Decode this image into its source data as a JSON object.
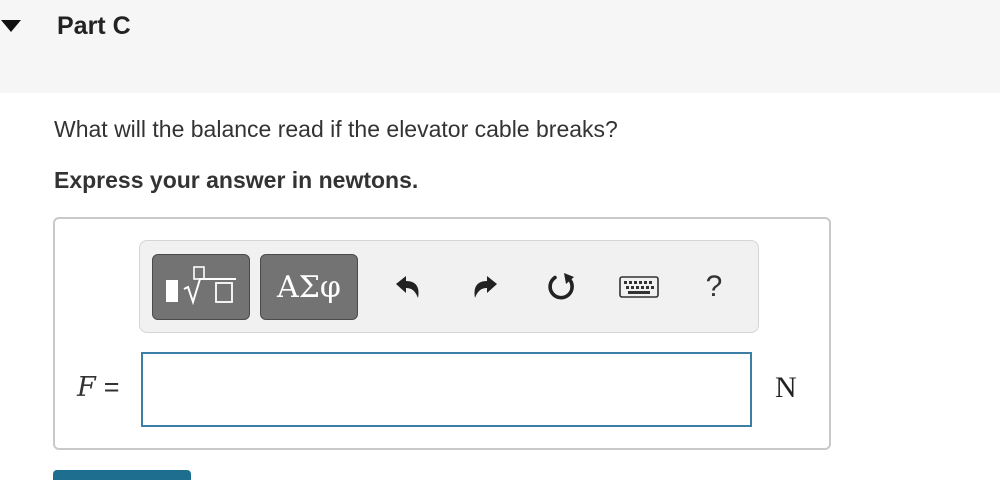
{
  "part": {
    "title": "Part C",
    "expanded": true
  },
  "question": {
    "text": "What will the balance read if the elevator cable breaks?",
    "instruction": "Express your answer in newtons."
  },
  "toolbar": {
    "templates_icon": "templates-sqrt-icon",
    "symbols_label": "ΑΣφ",
    "undo_icon": "undo-icon",
    "redo_icon": "redo-icon",
    "reset_icon": "reset-icon",
    "keyboard_icon": "keyboard-icon",
    "help_label": "?"
  },
  "answer": {
    "variable": "F",
    "equals": "=",
    "value": "",
    "unit": "N"
  },
  "colors": {
    "header_bg": "#f6f6f6",
    "input_border": "#3d7ea6",
    "button_bg": "#737373",
    "submit_button": "#1e6f8f"
  }
}
